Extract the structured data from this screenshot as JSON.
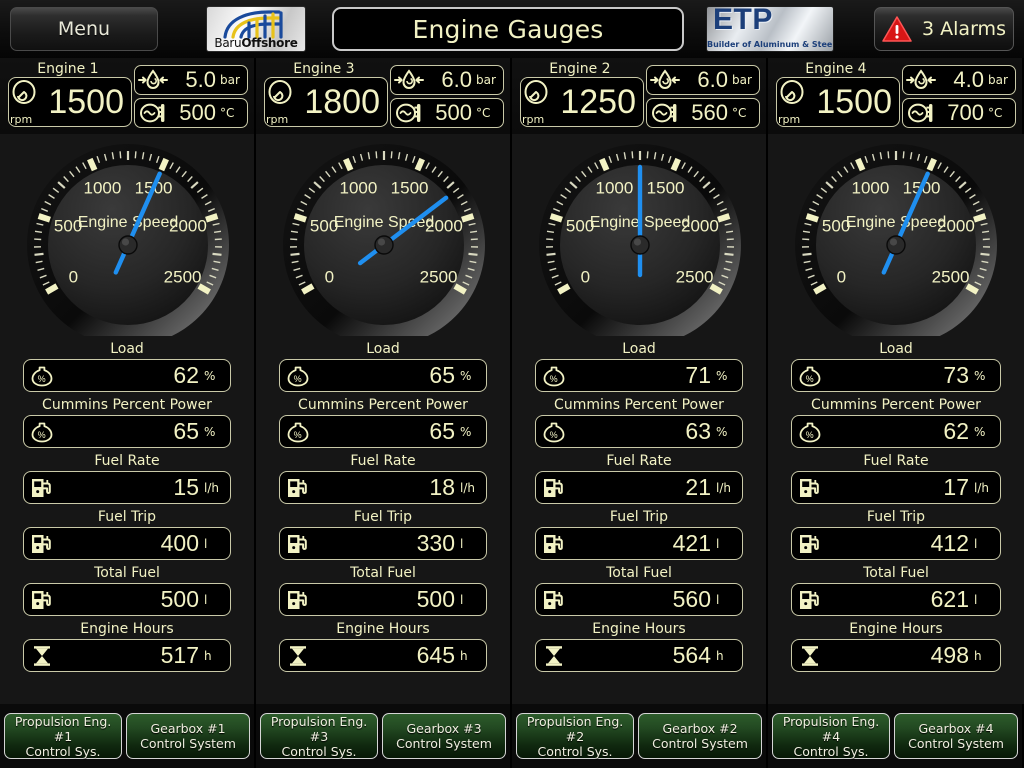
{
  "topbar": {
    "menu_label": "Menu",
    "title": "Engine Gauges",
    "alarm_label": "3 Alarms",
    "alarm_icon": "warning-triangle-icon",
    "left_logo": {
      "name": "baru-offshore-logo",
      "text_light": "Baru",
      "text_bold": "Offshore"
    },
    "right_logo": {
      "name": "etp-logo",
      "title": "ETP",
      "subtitle": "Builder of Aluminum & Steel Vessels"
    }
  },
  "gauge_common": {
    "dial_title": "Engine Speed",
    "min": 0,
    "max": 2500,
    "major_ticks": [
      "0",
      "500",
      "1000",
      "1500",
      "2000",
      "2500"
    ],
    "needle_color": "#1f8ff0",
    "text_color": "#f2f2c4"
  },
  "units": {
    "rpm": "rpm",
    "pressure": "bar",
    "temperature": "°C",
    "percent": "%",
    "fuel_rate": "l/h",
    "liters": "l",
    "hours": "h"
  },
  "row_labels": {
    "load": "Load",
    "percent_power": "Cummins Percent Power",
    "fuel_rate": "Fuel Rate",
    "fuel_trip": "Fuel Trip",
    "total_fuel": "Total Fuel",
    "engine_hours": "Engine Hours"
  },
  "engines": [
    {
      "name": "Engine 1",
      "rpm": "1500",
      "rpm_numeric": 1500,
      "oil_pressure": "5.0",
      "exhaust_temp": "500",
      "load": "62",
      "percent_power": "65",
      "fuel_rate": "15",
      "fuel_trip": "400",
      "total_fuel": "500",
      "engine_hours": "517",
      "btn_engine": "Propulsion Eng. #1\nControl Sys.",
      "btn_engine_line1": "Propulsion Eng. #1",
      "btn_engine_line2": "Control Sys.",
      "btn_gearbox_line1": "Gearbox #1",
      "btn_gearbox_line2": "Control System"
    },
    {
      "name": "Engine 3",
      "rpm": "1800",
      "rpm_numeric": 1800,
      "oil_pressure": "6.0",
      "exhaust_temp": "500",
      "load": "65",
      "percent_power": "65",
      "fuel_rate": "18",
      "fuel_trip": "330",
      "total_fuel": "500",
      "engine_hours": "645",
      "btn_engine_line1": "Propulsion Eng. #3",
      "btn_engine_line2": "Control Sys.",
      "btn_gearbox_line1": "Gearbox #3",
      "btn_gearbox_line2": "Control System"
    },
    {
      "name": "Engine 2",
      "rpm": "1250",
      "rpm_numeric": 1250,
      "oil_pressure": "6.0",
      "exhaust_temp": "560",
      "load": "71",
      "percent_power": "63",
      "fuel_rate": "21",
      "fuel_trip": "421",
      "total_fuel": "560",
      "engine_hours": "564",
      "btn_engine_line1": "Propulsion Eng. #2",
      "btn_engine_line2": "Control Sys.",
      "btn_gearbox_line1": "Gearbox #2",
      "btn_gearbox_line2": "Control System"
    },
    {
      "name": "Engine 4",
      "rpm": "1500",
      "rpm_numeric": 1500,
      "oil_pressure": "4.0",
      "exhaust_temp": "700",
      "load": "73",
      "percent_power": "62",
      "fuel_rate": "17",
      "fuel_trip": "412",
      "total_fuel": "621",
      "engine_hours": "498",
      "btn_engine_line1": "Propulsion Eng. #4",
      "btn_engine_line2": "Control Sys.",
      "btn_gearbox_line1": "Gearbox #4",
      "btn_gearbox_line2": "Control System"
    }
  ],
  "icons": {
    "rpm": "tachometer-icon",
    "oil_pressure": "oil-pressure-droplet-icon",
    "exhaust_temp": "thermometer-icon",
    "percent": "percent-load-icon",
    "fuel": "fuel-pump-icon",
    "hours": "hourglass-icon"
  }
}
